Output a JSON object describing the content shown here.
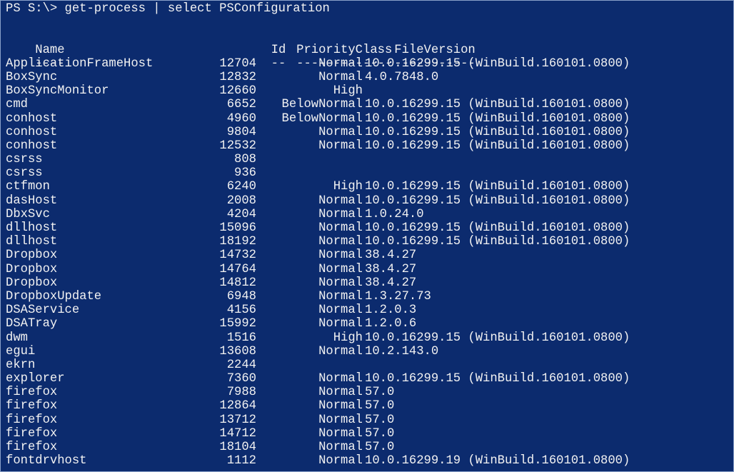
{
  "prompt": "PS S:\\> get-process | select PSConfiguration",
  "headers": {
    "name": "Name",
    "id": "Id",
    "priority": "PriorityClass",
    "version": "FileVersion"
  },
  "separators": {
    "name": "----",
    "id": "--",
    "priority": "-------------",
    "version": "-----------"
  },
  "rows": [
    {
      "name": "ApplicationFrameHost",
      "id": "12704",
      "priority": "Normal",
      "version": "10.0.16299.15 (WinBuild.160101.0800)"
    },
    {
      "name": "BoxSync",
      "id": "12832",
      "priority": "Normal",
      "version": "4.0.7848.0"
    },
    {
      "name": "BoxSyncMonitor",
      "id": "12660",
      "priority": "High",
      "version": ""
    },
    {
      "name": "cmd",
      "id": "6652",
      "priority": "BelowNormal",
      "version": "10.0.16299.15 (WinBuild.160101.0800)"
    },
    {
      "name": "conhost",
      "id": "4960",
      "priority": "BelowNormal",
      "version": "10.0.16299.15 (WinBuild.160101.0800)"
    },
    {
      "name": "conhost",
      "id": "9804",
      "priority": "Normal",
      "version": "10.0.16299.15 (WinBuild.160101.0800)"
    },
    {
      "name": "conhost",
      "id": "12532",
      "priority": "Normal",
      "version": "10.0.16299.15 (WinBuild.160101.0800)"
    },
    {
      "name": "csrss",
      "id": "808",
      "priority": "",
      "version": ""
    },
    {
      "name": "csrss",
      "id": "936",
      "priority": "",
      "version": ""
    },
    {
      "name": "ctfmon",
      "id": "6240",
      "priority": "High",
      "version": "10.0.16299.15 (WinBuild.160101.0800)"
    },
    {
      "name": "dasHost",
      "id": "2008",
      "priority": "Normal",
      "version": "10.0.16299.15 (WinBuild.160101.0800)"
    },
    {
      "name": "DbxSvc",
      "id": "4204",
      "priority": "Normal",
      "version": "1.0.24.0"
    },
    {
      "name": "dllhost",
      "id": "15096",
      "priority": "Normal",
      "version": "10.0.16299.15 (WinBuild.160101.0800)"
    },
    {
      "name": "dllhost",
      "id": "18192",
      "priority": "Normal",
      "version": "10.0.16299.15 (WinBuild.160101.0800)"
    },
    {
      "name": "Dropbox",
      "id": "14732",
      "priority": "Normal",
      "version": "38.4.27"
    },
    {
      "name": "Dropbox",
      "id": "14764",
      "priority": "Normal",
      "version": "38.4.27"
    },
    {
      "name": "Dropbox",
      "id": "14812",
      "priority": "Normal",
      "version": "38.4.27"
    },
    {
      "name": "DropboxUpdate",
      "id": "6948",
      "priority": "Normal",
      "version": "1.3.27.73"
    },
    {
      "name": "DSAService",
      "id": "4156",
      "priority": "Normal",
      "version": "1.2.0.3"
    },
    {
      "name": "DSATray",
      "id": "15992",
      "priority": "Normal",
      "version": "1.2.0.6"
    },
    {
      "name": "dwm",
      "id": "1516",
      "priority": "High",
      "version": "10.0.16299.15 (WinBuild.160101.0800)"
    },
    {
      "name": "egui",
      "id": "13608",
      "priority": "Normal",
      "version": "10.2.143.0"
    },
    {
      "name": "ekrn",
      "id": "2244",
      "priority": "",
      "version": ""
    },
    {
      "name": "explorer",
      "id": "7360",
      "priority": "Normal",
      "version": "10.0.16299.15 (WinBuild.160101.0800)"
    },
    {
      "name": "firefox",
      "id": "7988",
      "priority": "Normal",
      "version": "57.0"
    },
    {
      "name": "firefox",
      "id": "12864",
      "priority": "Normal",
      "version": "57.0"
    },
    {
      "name": "firefox",
      "id": "13712",
      "priority": "Normal",
      "version": "57.0"
    },
    {
      "name": "firefox",
      "id": "14712",
      "priority": "Normal",
      "version": "57.0"
    },
    {
      "name": "firefox",
      "id": "18104",
      "priority": "Normal",
      "version": "57.0"
    },
    {
      "name": "fontdrvhost",
      "id": "1112",
      "priority": "Normal",
      "version": "10.0.16299.19 (WinBuild.160101.0800)"
    }
  ],
  "colors": {
    "background": "#0c2b6e",
    "text": "#f2f2f2"
  }
}
